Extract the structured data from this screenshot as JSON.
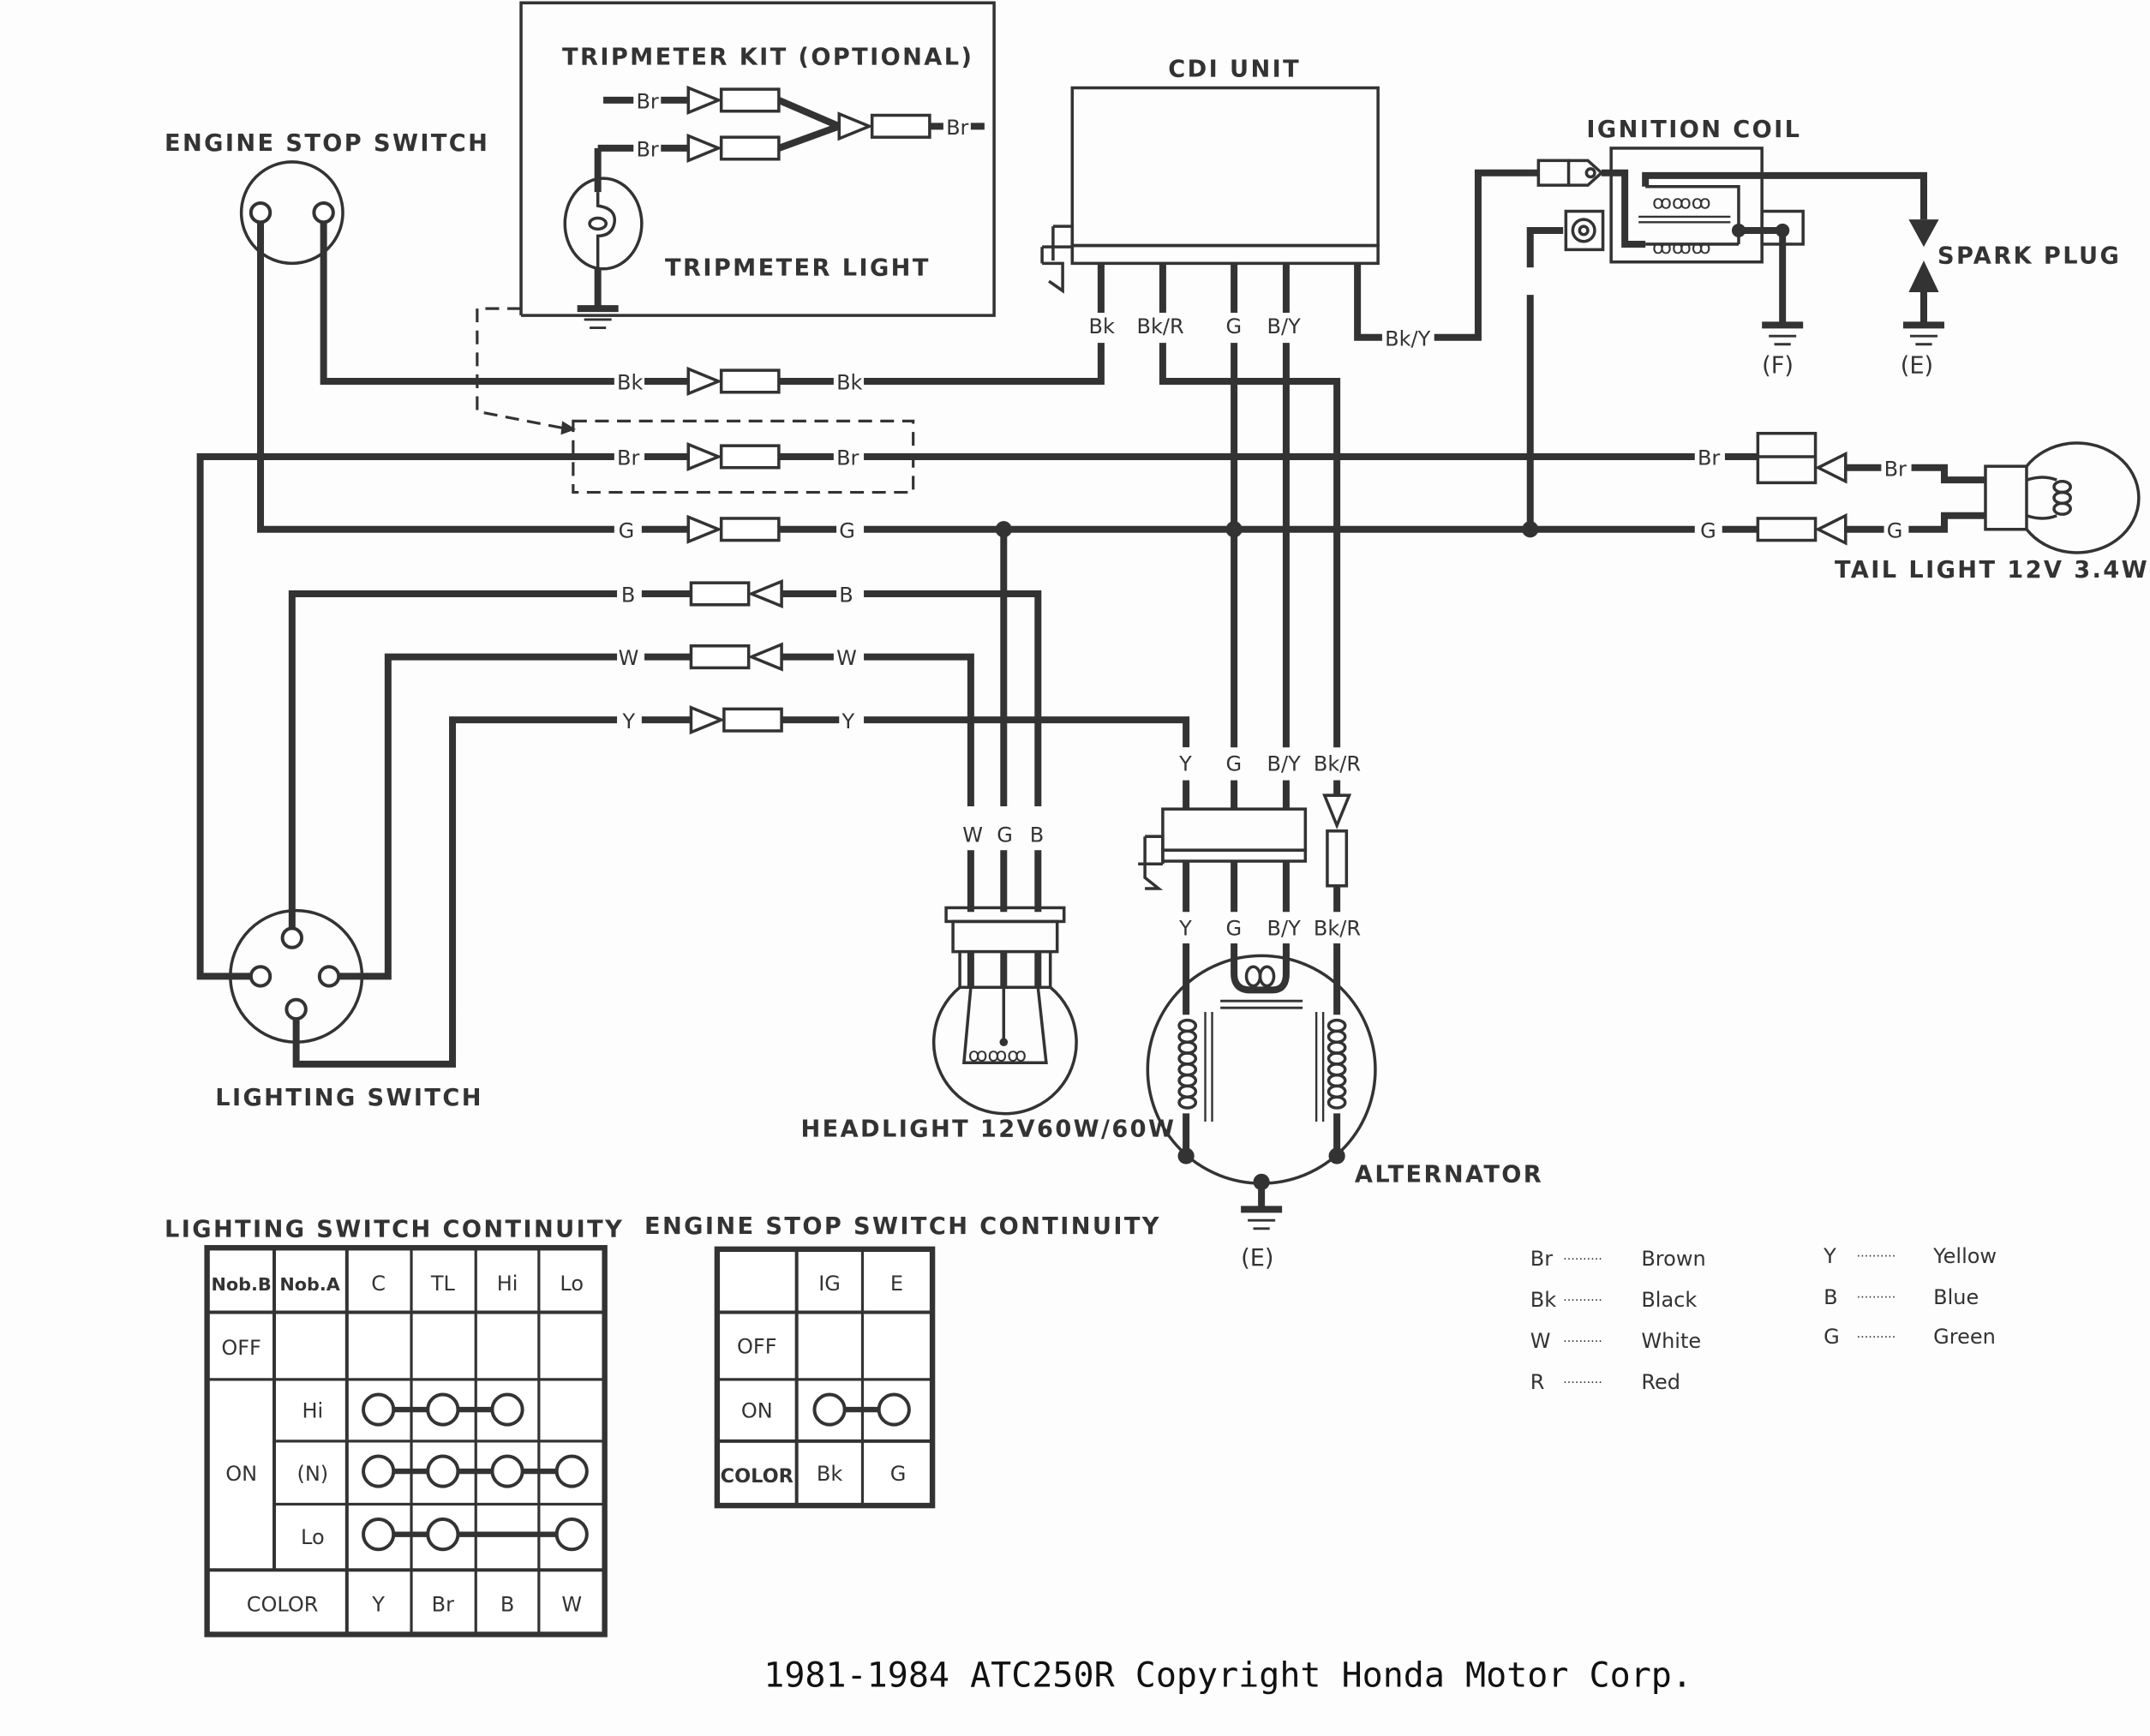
{
  "title": "1981-1984 ATC250R Copyright Honda Motor Corp.",
  "components": {
    "tripmeter_kit": "TRIPMETER KIT (OPTIONAL)",
    "tripmeter_light": "TRIPMETER LIGHT",
    "engine_stop_switch": "ENGINE STOP SWITCH",
    "cdi_unit": "CDI UNIT",
    "ignition_coil": "IGNITION COIL",
    "spark_plug": "SPARK PLUG",
    "tail_light": "TAIL LIGHT  12V 3.4W",
    "lighting_switch": "LIGHTING SWITCH",
    "headlight": "HEADLIGHT  12V60W/60W",
    "alternator": "ALTERNATOR",
    "ground_f": "(F)",
    "ground_e": "(E)",
    "ground_e2": "(E)"
  },
  "wire_labels": {
    "br": "Br",
    "bk": "Bk",
    "g": "G",
    "b": "B",
    "w": "W",
    "y": "Y",
    "bk_r": "Bk/R",
    "b_y": "B/Y",
    "bk_y": "Bk/Y"
  },
  "lighting_table": {
    "title": "LIGHTING SWITCH CONTINUITY",
    "headers": [
      "Nob.B",
      "Nob.A",
      "C",
      "TL",
      "Hi",
      "Lo"
    ],
    "rows": [
      {
        "nob_b": "OFF",
        "nob_a": "",
        "connected": []
      },
      {
        "nob_b": "ON",
        "nob_a": "Hi",
        "connected": [
          "C",
          "TL",
          "Hi"
        ]
      },
      {
        "nob_b": "ON",
        "nob_a": "(N)",
        "connected": [
          "C",
          "TL",
          "Hi",
          "Lo"
        ]
      },
      {
        "nob_b": "ON",
        "nob_a": "Lo",
        "connected": [
          "C",
          "TL",
          "Lo"
        ]
      }
    ],
    "row_labels": {
      "off": "OFF",
      "on": "ON",
      "hi": "Hi",
      "n": "(N)",
      "lo": "Lo"
    },
    "color_label": "COLOR",
    "colors": [
      "Y",
      "Br",
      "B",
      "W"
    ]
  },
  "engine_stop_table": {
    "title": "ENGINE STOP SWITCH CONTINUITY",
    "headers": [
      "",
      "IG",
      "E"
    ],
    "rows": [
      {
        "label": "OFF",
        "connected": []
      },
      {
        "label": "ON",
        "connected": [
          "IG",
          "E"
        ]
      }
    ],
    "color_label": "COLOR",
    "colors": [
      "Bk",
      "G"
    ]
  },
  "legend": [
    {
      "code": "Br",
      "name": "Brown"
    },
    {
      "code": "Bk",
      "name": "Black"
    },
    {
      "code": "W",
      "name": "White"
    },
    {
      "code": "R",
      "name": "Red"
    },
    {
      "code": "Y",
      "name": "Yellow"
    },
    {
      "code": "B",
      "name": "Blue"
    },
    {
      "code": "G",
      "name": "Green"
    }
  ],
  "legend_dots": "··········"
}
